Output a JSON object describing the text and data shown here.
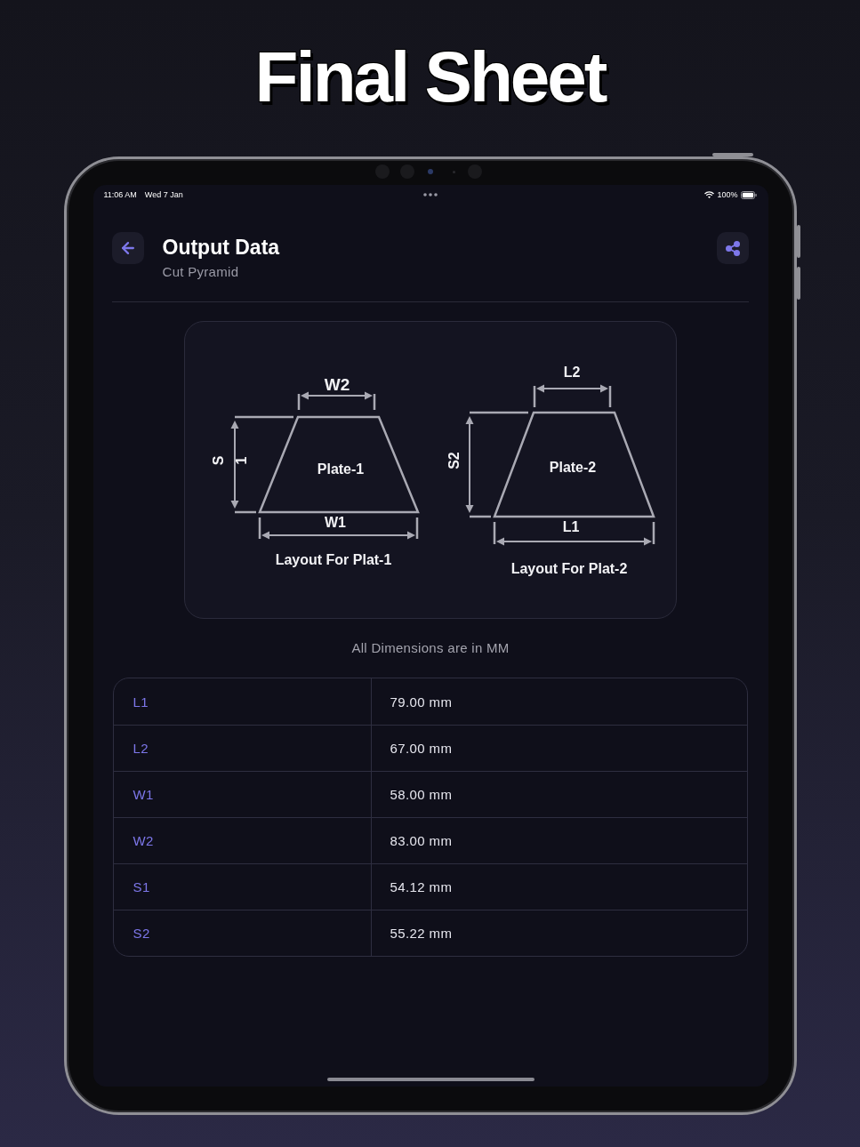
{
  "promo_title": "Final Sheet",
  "status_bar": {
    "time": "11:06 AM",
    "date": "Wed 7 Jan",
    "battery": "100%"
  },
  "header": {
    "title": "Output Data",
    "subtitle": "Cut Pyramid"
  },
  "diagram": {
    "plates": [
      {
        "label": "Plate-1",
        "top_dimension": "W2",
        "bottom_dimension": "W1",
        "side_dimension": [
          "S",
          "1"
        ],
        "caption": "Layout For Plat-1"
      },
      {
        "label": "Plate-2",
        "top_dimension": "L2",
        "bottom_dimension": "L1",
        "side_dimension": [
          "S2"
        ],
        "caption": "Layout For Plat-2"
      }
    ]
  },
  "note": "All Dimensions are in MM",
  "table": {
    "rows": [
      {
        "name": "L1",
        "value": "79.00 mm"
      },
      {
        "name": "L2",
        "value": "67.00 mm"
      },
      {
        "name": "W1",
        "value": "58.00 mm"
      },
      {
        "name": "W2",
        "value": "83.00 mm"
      },
      {
        "name": "S1",
        "value": "54.12 mm"
      },
      {
        "name": "S2",
        "value": "55.22 mm"
      }
    ]
  }
}
